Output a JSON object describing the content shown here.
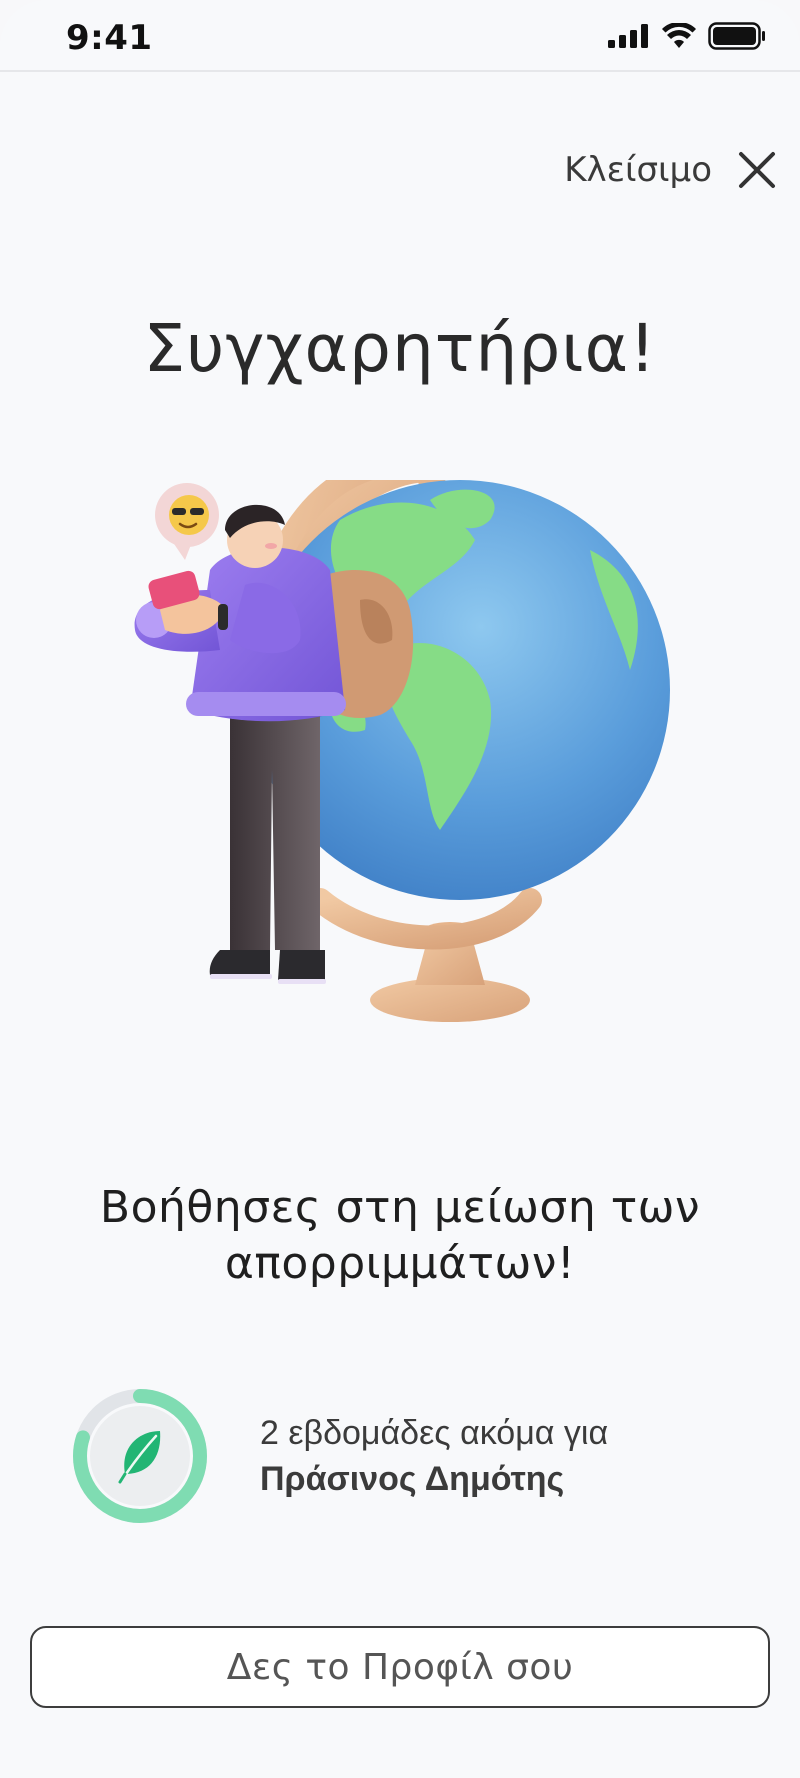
{
  "status_bar": {
    "time": "9:41",
    "icons": [
      "signal-icon",
      "wifi-icon",
      "battery-icon"
    ]
  },
  "close": {
    "label": "Κλείσιμο",
    "icon": "close-icon"
  },
  "title": "Συγχαρητήρια!",
  "illustration": {
    "subject": "person-with-phone-and-globe",
    "emoji_bubble": "sunglasses-emoji"
  },
  "message": {
    "line1": "Βοήθησες στη μείωση των",
    "line2": "απορριμμάτων!"
  },
  "progress": {
    "icon": "leaf-icon",
    "text": "2 εβδομάδες ακόμα για",
    "target": "Πράσινος Δημότης",
    "fraction": 0.8,
    "ring_color": "#7fdcb2",
    "leaf_color": "#22b574"
  },
  "cta": {
    "label": "Δες το Προφίλ σου"
  }
}
